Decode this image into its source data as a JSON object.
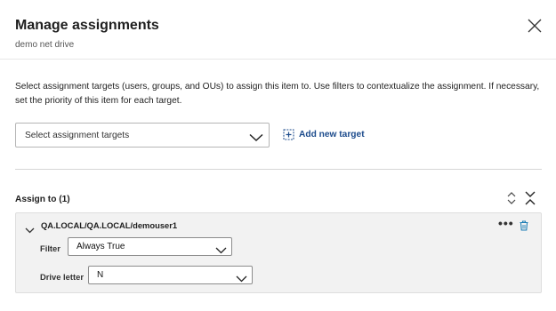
{
  "dialog": {
    "title": "Manage assignments",
    "subtitle": "demo net drive",
    "close_icon": "close-icon"
  },
  "description": "Select assignment targets (users, groups, and OUs) to assign this item to. Use filters to contextualize the assignment. If necessary, set the priority of this item for each target.",
  "target_select": {
    "placeholder": "Select assignment targets",
    "icon": "chevron-down-icon"
  },
  "add_target": {
    "label": "Add new target",
    "icon": "add-square-icon"
  },
  "assign_section": {
    "label": "Assign to (1)",
    "sort_icon": "sort-up-down-icon",
    "collapse_icon": "collapse-all-icon"
  },
  "targets": [
    {
      "name": "QA.LOCAL/QA.LOCAL/demouser1",
      "more_label": "•••",
      "filter": {
        "label": "Filter",
        "value": "Always True"
      },
      "drive_letter": {
        "label": "Drive letter",
        "value": "N"
      }
    }
  ],
  "colors": {
    "accent": "#1c4b8c",
    "card_bg": "#f2f2f2",
    "trash": "#1f7fb6"
  }
}
